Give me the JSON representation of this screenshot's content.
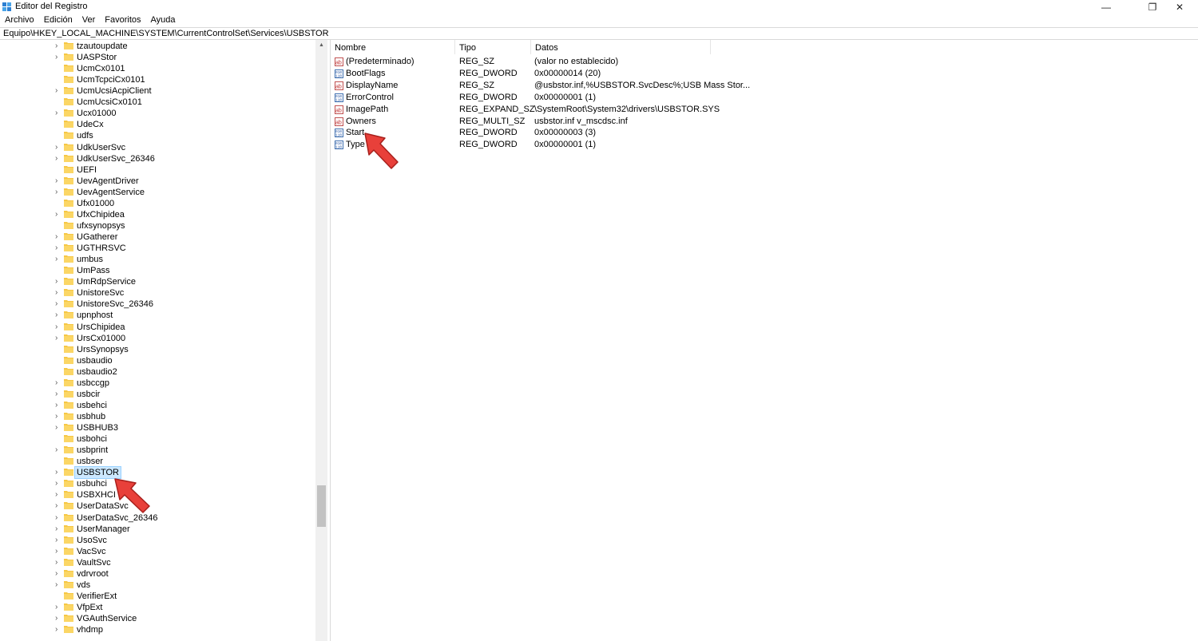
{
  "window": {
    "title": "Editor del Registro",
    "minimize_glyph": "—",
    "maximize_glyph": "❐",
    "close_glyph": "✕"
  },
  "menu": [
    "Archivo",
    "Edición",
    "Ver",
    "Favoritos",
    "Ayuda"
  ],
  "address": "Equipo\\HKEY_LOCAL_MACHINE\\SYSTEM\\CurrentControlSet\\Services\\USBSTOR",
  "tree": {
    "items": [
      {
        "label": "tzautoupdate",
        "expandable": true
      },
      {
        "label": "UASPStor",
        "expandable": true
      },
      {
        "label": "UcmCx0101",
        "expandable": false
      },
      {
        "label": "UcmTcpciCx0101",
        "expandable": false
      },
      {
        "label": "UcmUcsiAcpiClient",
        "expandable": true
      },
      {
        "label": "UcmUcsiCx0101",
        "expandable": false
      },
      {
        "label": "Ucx01000",
        "expandable": true
      },
      {
        "label": "UdeCx",
        "expandable": false
      },
      {
        "label": "udfs",
        "expandable": false
      },
      {
        "label": "UdkUserSvc",
        "expandable": true
      },
      {
        "label": "UdkUserSvc_26346",
        "expandable": true
      },
      {
        "label": "UEFI",
        "expandable": false
      },
      {
        "label": "UevAgentDriver",
        "expandable": true
      },
      {
        "label": "UevAgentService",
        "expandable": true
      },
      {
        "label": "Ufx01000",
        "expandable": false
      },
      {
        "label": "UfxChipidea",
        "expandable": true
      },
      {
        "label": "ufxsynopsys",
        "expandable": false
      },
      {
        "label": "UGatherer",
        "expandable": true
      },
      {
        "label": "UGTHRSVC",
        "expandable": true
      },
      {
        "label": "umbus",
        "expandable": true
      },
      {
        "label": "UmPass",
        "expandable": false
      },
      {
        "label": "UmRdpService",
        "expandable": true
      },
      {
        "label": "UnistoreSvc",
        "expandable": true
      },
      {
        "label": "UnistoreSvc_26346",
        "expandable": true
      },
      {
        "label": "upnphost",
        "expandable": true
      },
      {
        "label": "UrsChipidea",
        "expandable": true
      },
      {
        "label": "UrsCx01000",
        "expandable": true
      },
      {
        "label": "UrsSynopsys",
        "expandable": false
      },
      {
        "label": "usbaudio",
        "expandable": false
      },
      {
        "label": "usbaudio2",
        "expandable": false
      },
      {
        "label": "usbccgp",
        "expandable": true
      },
      {
        "label": "usbcir",
        "expandable": true
      },
      {
        "label": "usbehci",
        "expandable": true
      },
      {
        "label": "usbhub",
        "expandable": true
      },
      {
        "label": "USBHUB3",
        "expandable": true
      },
      {
        "label": "usbohci",
        "expandable": false
      },
      {
        "label": "usbprint",
        "expandable": true
      },
      {
        "label": "usbser",
        "expandable": false
      },
      {
        "label": "USBSTOR",
        "expandable": true,
        "selected": true
      },
      {
        "label": "usbuhci",
        "expandable": true
      },
      {
        "label": "USBXHCI",
        "expandable": true
      },
      {
        "label": "UserDataSvc",
        "expandable": true
      },
      {
        "label": "UserDataSvc_26346",
        "expandable": true
      },
      {
        "label": "UserManager",
        "expandable": true
      },
      {
        "label": "UsoSvc",
        "expandable": true
      },
      {
        "label": "VacSvc",
        "expandable": true
      },
      {
        "label": "VaultSvc",
        "expandable": true
      },
      {
        "label": "vdrvroot",
        "expandable": true
      },
      {
        "label": "vds",
        "expandable": true
      },
      {
        "label": "VerifierExt",
        "expandable": false
      },
      {
        "label": "VfpExt",
        "expandable": true
      },
      {
        "label": "VGAuthService",
        "expandable": true
      },
      {
        "label": "vhdmp",
        "expandable": true
      }
    ]
  },
  "list": {
    "columns": [
      "Nombre",
      "Tipo",
      "Datos"
    ],
    "rows": [
      {
        "icon": "string-value-icon",
        "name": "(Predeterminado)",
        "type": "REG_SZ",
        "data": "(valor no establecido)"
      },
      {
        "icon": "binary-value-icon",
        "name": "BootFlags",
        "type": "REG_DWORD",
        "data": "0x00000014 (20)"
      },
      {
        "icon": "string-value-icon",
        "name": "DisplayName",
        "type": "REG_SZ",
        "data": "@usbstor.inf,%USBSTOR.SvcDesc%;USB Mass Stor..."
      },
      {
        "icon": "binary-value-icon",
        "name": "ErrorControl",
        "type": "REG_DWORD",
        "data": "0x00000001 (1)"
      },
      {
        "icon": "string-value-icon",
        "name": "ImagePath",
        "type": "REG_EXPAND_SZ",
        "data": "\\SystemRoot\\System32\\drivers\\USBSTOR.SYS"
      },
      {
        "icon": "string-value-icon",
        "name": "Owners",
        "type": "REG_MULTI_SZ",
        "data": "usbstor.inf v_mscdsc.inf"
      },
      {
        "icon": "binary-value-icon",
        "name": "Start",
        "type": "REG_DWORD",
        "data": "0x00000003 (3)"
      },
      {
        "icon": "binary-value-icon",
        "name": "Type",
        "type": "REG_DWORD",
        "data": "0x00000001 (1)"
      }
    ]
  },
  "colors": {
    "folder": "#f6c744",
    "selection": "#cce8ff",
    "arrow": "#e8403a"
  }
}
